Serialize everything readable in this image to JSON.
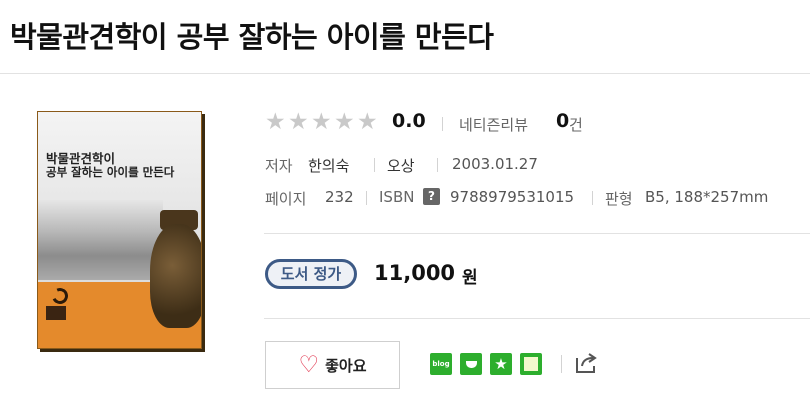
{
  "product": {
    "title": "박물관견학이 공부 잘하는 아이를 만든다"
  },
  "cover": {
    "line1": "박물관견학이",
    "line2": "공부 잘하는 아이를 만든다"
  },
  "rating": {
    "stars_max": 5,
    "stars_filled": 0,
    "score": "0.0",
    "review_label": "네티즌리뷰",
    "review_count": "0",
    "review_unit": "건"
  },
  "meta": {
    "author_label": "저자",
    "author": "한의숙",
    "publisher": "오상",
    "date": "2003.01.27",
    "pages_label": "페이지",
    "pages": "232",
    "isbn_label": "ISBN",
    "isbn_help": "?",
    "isbn": "9788979531015",
    "format_label": "판형",
    "format": "B5, 188*257mm"
  },
  "price": {
    "badge": "도서 정가",
    "amount": "11,000",
    "unit": "원"
  },
  "actions": {
    "like_label": "좋아요",
    "blog_label": "blog"
  },
  "colors": {
    "star_empty": "#c9c9c9",
    "badge": "#3d5a86",
    "heart": "#e0304a",
    "share_green": "#2dae2d"
  }
}
